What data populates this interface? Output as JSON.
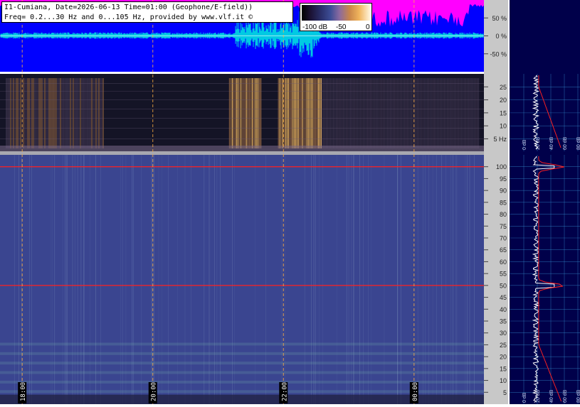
{
  "header": {
    "line1": "I1-Cumiana, Date=2026-06-13 Time=01:00 (Geophone/E-field))",
    "line2": "Freq= 0.2...30 Hz and 0...105 Hz, provided by www.vlf.it ©"
  },
  "colorbar": {
    "labels": [
      "-100 dB",
      "-50",
      "0"
    ]
  },
  "colors": {
    "page_bg": "#ffffff",
    "scale_bg": "#c8c8c8",
    "sidebar_bg": "#00004a",
    "waveform_bg": "#0000ff",
    "waveform_clip": "#ff00ff",
    "waveform_trace": "#00e0e0",
    "spectro_low_bg": "#141426",
    "spectro_high_bg": "#3a4590",
    "time_marker": "#ffb040",
    "mains_line": "#ff2020",
    "profile_trace": "#ffffff",
    "profile_avg": "#ff2020",
    "profile_grid": "#3a9ad8"
  },
  "chart_data": [
    {
      "type": "line",
      "panel": "waveform",
      "title": "",
      "ylabel": "",
      "y_ticks": [
        "50 %",
        "0 %",
        "-50 %"
      ],
      "y_tick_values": [
        50,
        0,
        -50
      ],
      "ylim": [
        -100,
        100
      ],
      "series": [
        {
          "values": []
        }
      ]
    },
    {
      "type": "heatmap",
      "panel": "spectrogram-low",
      "title": "",
      "y_ticks": [
        "25",
        "20",
        "15",
        "10",
        "5 Hz"
      ],
      "y_tick_values": [
        25,
        20,
        15,
        10,
        5
      ],
      "ylim": [
        0.2,
        30
      ],
      "time_ticks": [
        "18:00",
        "20:00",
        "22:00",
        "00:00"
      ],
      "activity_bands": [
        {
          "start": "17:45",
          "end": "19:15",
          "level": 0.45
        },
        {
          "start": "21:10",
          "end": "21:40",
          "level": 0.9
        },
        {
          "start": "21:55",
          "end": "22:35",
          "level": 0.95
        },
        {
          "start": "22:35",
          "end": "01:00",
          "level": 0.2
        }
      ]
    },
    {
      "type": "heatmap",
      "panel": "spectrogram-high",
      "title": "",
      "y_ticks": [
        "100",
        "95",
        "90",
        "85",
        "80",
        "75",
        "70",
        "65",
        "60",
        "55",
        "50",
        "45",
        "40",
        "35",
        "30",
        "25",
        "20",
        "15",
        "10",
        "5"
      ],
      "y_tick_values": [
        100,
        95,
        90,
        85,
        80,
        75,
        70,
        65,
        60,
        55,
        50,
        45,
        40,
        35,
        30,
        25,
        20,
        15,
        10,
        5
      ],
      "ylim": [
        0,
        105
      ],
      "time_ticks": [
        "18:00",
        "20:00",
        "22:00",
        "00:00"
      ],
      "mains_lines_hz": [
        50,
        100
      ]
    },
    {
      "type": "line",
      "panel": "profile-low",
      "x_ticks": [
        "0 dB",
        "20 dB",
        "40 dB",
        "60 dB",
        "80 dB"
      ],
      "x_tick_values": [
        0,
        20,
        40,
        60,
        80
      ],
      "ylim": [
        0.2,
        30
      ]
    },
    {
      "type": "line",
      "panel": "profile-high",
      "x_ticks": [
        "0 dB",
        "20 dB",
        "40 dB",
        "60 dB",
        "80 dB"
      ],
      "x_tick_values": [
        0,
        20,
        40,
        60,
        80
      ],
      "ylim": [
        0,
        105
      ],
      "peaks_hz": [
        50,
        100
      ]
    }
  ]
}
